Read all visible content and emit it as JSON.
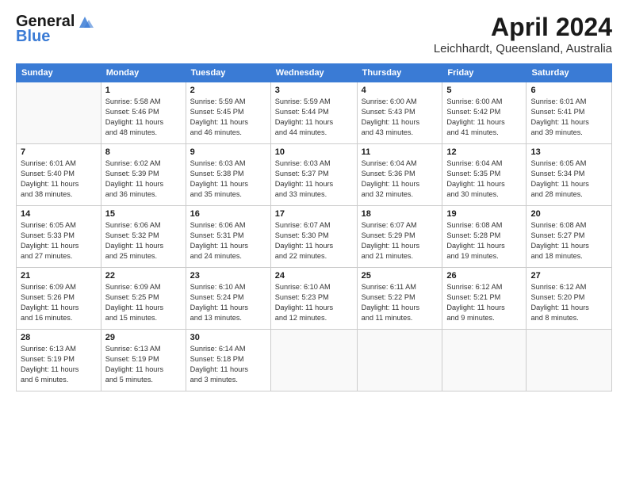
{
  "header": {
    "logo_line1": "General",
    "logo_line2": "Blue",
    "month": "April 2024",
    "location": "Leichhardt, Queensland, Australia"
  },
  "weekdays": [
    "Sunday",
    "Monday",
    "Tuesday",
    "Wednesday",
    "Thursday",
    "Friday",
    "Saturday"
  ],
  "weeks": [
    [
      {
        "day": "",
        "info": ""
      },
      {
        "day": "1",
        "info": "Sunrise: 5:58 AM\nSunset: 5:46 PM\nDaylight: 11 hours\nand 48 minutes."
      },
      {
        "day": "2",
        "info": "Sunrise: 5:59 AM\nSunset: 5:45 PM\nDaylight: 11 hours\nand 46 minutes."
      },
      {
        "day": "3",
        "info": "Sunrise: 5:59 AM\nSunset: 5:44 PM\nDaylight: 11 hours\nand 44 minutes."
      },
      {
        "day": "4",
        "info": "Sunrise: 6:00 AM\nSunset: 5:43 PM\nDaylight: 11 hours\nand 43 minutes."
      },
      {
        "day": "5",
        "info": "Sunrise: 6:00 AM\nSunset: 5:42 PM\nDaylight: 11 hours\nand 41 minutes."
      },
      {
        "day": "6",
        "info": "Sunrise: 6:01 AM\nSunset: 5:41 PM\nDaylight: 11 hours\nand 39 minutes."
      }
    ],
    [
      {
        "day": "7",
        "info": "Sunrise: 6:01 AM\nSunset: 5:40 PM\nDaylight: 11 hours\nand 38 minutes."
      },
      {
        "day": "8",
        "info": "Sunrise: 6:02 AM\nSunset: 5:39 PM\nDaylight: 11 hours\nand 36 minutes."
      },
      {
        "day": "9",
        "info": "Sunrise: 6:03 AM\nSunset: 5:38 PM\nDaylight: 11 hours\nand 35 minutes."
      },
      {
        "day": "10",
        "info": "Sunrise: 6:03 AM\nSunset: 5:37 PM\nDaylight: 11 hours\nand 33 minutes."
      },
      {
        "day": "11",
        "info": "Sunrise: 6:04 AM\nSunset: 5:36 PM\nDaylight: 11 hours\nand 32 minutes."
      },
      {
        "day": "12",
        "info": "Sunrise: 6:04 AM\nSunset: 5:35 PM\nDaylight: 11 hours\nand 30 minutes."
      },
      {
        "day": "13",
        "info": "Sunrise: 6:05 AM\nSunset: 5:34 PM\nDaylight: 11 hours\nand 28 minutes."
      }
    ],
    [
      {
        "day": "14",
        "info": "Sunrise: 6:05 AM\nSunset: 5:33 PM\nDaylight: 11 hours\nand 27 minutes."
      },
      {
        "day": "15",
        "info": "Sunrise: 6:06 AM\nSunset: 5:32 PM\nDaylight: 11 hours\nand 25 minutes."
      },
      {
        "day": "16",
        "info": "Sunrise: 6:06 AM\nSunset: 5:31 PM\nDaylight: 11 hours\nand 24 minutes."
      },
      {
        "day": "17",
        "info": "Sunrise: 6:07 AM\nSunset: 5:30 PM\nDaylight: 11 hours\nand 22 minutes."
      },
      {
        "day": "18",
        "info": "Sunrise: 6:07 AM\nSunset: 5:29 PM\nDaylight: 11 hours\nand 21 minutes."
      },
      {
        "day": "19",
        "info": "Sunrise: 6:08 AM\nSunset: 5:28 PM\nDaylight: 11 hours\nand 19 minutes."
      },
      {
        "day": "20",
        "info": "Sunrise: 6:08 AM\nSunset: 5:27 PM\nDaylight: 11 hours\nand 18 minutes."
      }
    ],
    [
      {
        "day": "21",
        "info": "Sunrise: 6:09 AM\nSunset: 5:26 PM\nDaylight: 11 hours\nand 16 minutes."
      },
      {
        "day": "22",
        "info": "Sunrise: 6:09 AM\nSunset: 5:25 PM\nDaylight: 11 hours\nand 15 minutes."
      },
      {
        "day": "23",
        "info": "Sunrise: 6:10 AM\nSunset: 5:24 PM\nDaylight: 11 hours\nand 13 minutes."
      },
      {
        "day": "24",
        "info": "Sunrise: 6:10 AM\nSunset: 5:23 PM\nDaylight: 11 hours\nand 12 minutes."
      },
      {
        "day": "25",
        "info": "Sunrise: 6:11 AM\nSunset: 5:22 PM\nDaylight: 11 hours\nand 11 minutes."
      },
      {
        "day": "26",
        "info": "Sunrise: 6:12 AM\nSunset: 5:21 PM\nDaylight: 11 hours\nand 9 minutes."
      },
      {
        "day": "27",
        "info": "Sunrise: 6:12 AM\nSunset: 5:20 PM\nDaylight: 11 hours\nand 8 minutes."
      }
    ],
    [
      {
        "day": "28",
        "info": "Sunrise: 6:13 AM\nSunset: 5:19 PM\nDaylight: 11 hours\nand 6 minutes."
      },
      {
        "day": "29",
        "info": "Sunrise: 6:13 AM\nSunset: 5:19 PM\nDaylight: 11 hours\nand 5 minutes."
      },
      {
        "day": "30",
        "info": "Sunrise: 6:14 AM\nSunset: 5:18 PM\nDaylight: 11 hours\nand 3 minutes."
      },
      {
        "day": "",
        "info": ""
      },
      {
        "day": "",
        "info": ""
      },
      {
        "day": "",
        "info": ""
      },
      {
        "day": "",
        "info": ""
      }
    ]
  ]
}
